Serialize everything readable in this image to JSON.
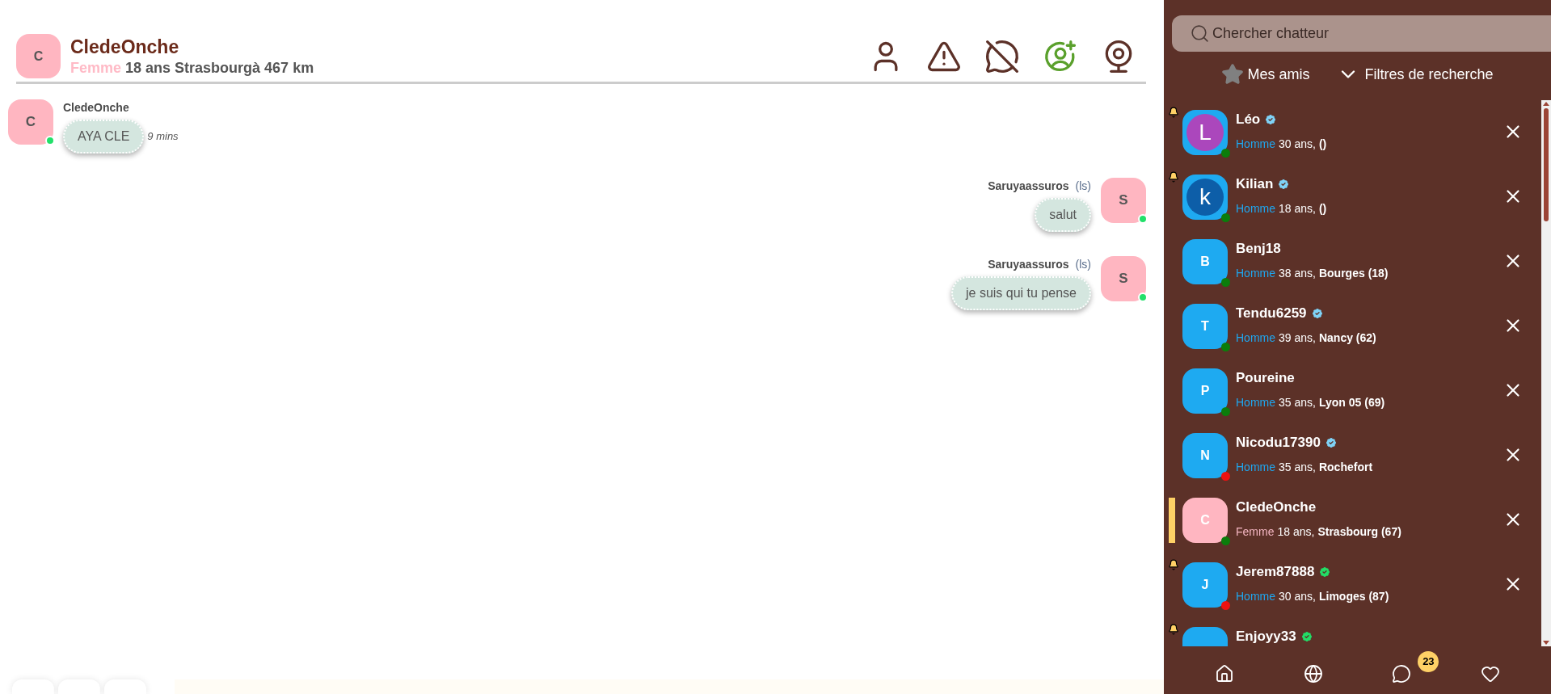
{
  "header": {
    "avatar_letter": "C",
    "name": "CledeOnche",
    "gender": "Femme",
    "details": "18 ans Strasbourgà 467 km",
    "actions": [
      {
        "kind": "profile"
      },
      {
        "kind": "report"
      },
      {
        "kind": "block-chat"
      },
      {
        "kind": "add-friend"
      },
      {
        "kind": "webcam"
      }
    ]
  },
  "messages": [
    {
      "kind": "incoming",
      "avatar_letter": "C",
      "online": true,
      "sender": "CledeOnche",
      "text": "AYA CLE",
      "time": "9 mins"
    },
    {
      "kind": "outgoing",
      "avatar_letter": "S",
      "online": true,
      "sender": "Saruyaassuros",
      "tag": "(ls)",
      "text": "salut"
    },
    {
      "kind": "outgoing",
      "avatar_letter": "S",
      "online": true,
      "sender": "Saruyaassuros",
      "tag": "(ls)",
      "text": "je suis qui tu pense"
    }
  ],
  "composer_buttons": [
    {
      "kind": "tool"
    },
    {
      "kind": "tool"
    },
    {
      "kind": "tool"
    }
  ],
  "sidebar": {
    "search": {
      "placeholder": "Chercher chatteur"
    },
    "friends_label": "Mes amis",
    "filters_label": "Filtres de recherche",
    "users": [
      {
        "name": "Léo",
        "avatar": {
          "kind": "round",
          "color": "#ab47bc",
          "letter": "L"
        },
        "status": {
          "color": "#0b7d0b"
        },
        "badge": {
          "color": "#7fd3f7"
        },
        "notified": true,
        "selected": false,
        "gender": {
          "text": "Homme",
          "color": "#1ea7f0"
        },
        "age": "30 ans,",
        "place": "()"
      },
      {
        "name": "Kilian",
        "avatar": {
          "kind": "round",
          "color": "#0d5ea8",
          "letter": "k"
        },
        "status": {
          "color": "#0b7d0b"
        },
        "badge": {
          "color": "#7fd3f7"
        },
        "notified": true,
        "selected": false,
        "gender": {
          "text": "Homme",
          "color": "#1ea7f0"
        },
        "age": "18 ans,",
        "place": "()"
      },
      {
        "name": "Benj18",
        "avatar": {
          "kind": "square",
          "color": "#1eaaf1",
          "letter": "B"
        },
        "status": {
          "color": "#0b7d0b"
        },
        "notified": false,
        "selected": false,
        "gender": {
          "text": "Homme",
          "color": "#1ea7f0"
        },
        "age": "38 ans,",
        "place": "Bourges (18)"
      },
      {
        "name": "Tendu6259",
        "avatar": {
          "kind": "square",
          "color": "#1eaaf1",
          "letter": "T"
        },
        "status": {
          "color": "#0b7d0b"
        },
        "badge": {
          "color": "#7fd3f7"
        },
        "notified": false,
        "selected": false,
        "gender": {
          "text": "Homme",
          "color": "#1ea7f0"
        },
        "age": "39 ans,",
        "place": "Nancy (62)"
      },
      {
        "name": "Poureine",
        "avatar": {
          "kind": "square",
          "color": "#1eaaf1",
          "letter": "P"
        },
        "status": {
          "color": "#0b7d0b"
        },
        "notified": false,
        "selected": false,
        "gender": {
          "text": "Homme",
          "color": "#1ea7f0"
        },
        "age": "35 ans,",
        "place": "Lyon 05 (69)"
      },
      {
        "name": "Nicodu17390",
        "avatar": {
          "kind": "square",
          "color": "#1eaaf1",
          "letter": "N"
        },
        "status": {
          "color": "#ee1111"
        },
        "badge": {
          "color": "#7fd3f7"
        },
        "notified": false,
        "selected": false,
        "gender": {
          "text": "Homme",
          "color": "#1ea7f0"
        },
        "age": "35 ans,",
        "place": "Rochefort"
      },
      {
        "name": "CledeOnche",
        "avatar": {
          "kind": "square",
          "color": "#ffb6c1",
          "letter": "C"
        },
        "status": {
          "color": "#0b7d0b"
        },
        "notified": false,
        "selected": true,
        "gender": {
          "text": "Femme",
          "color": "#f4b6c2"
        },
        "age": "18 ans,",
        "place": "Strasbourg (67)"
      },
      {
        "name": "Jerem87888",
        "avatar": {
          "kind": "square",
          "color": "#1eaaf1",
          "letter": "J"
        },
        "status": {
          "color": "#ee1111"
        },
        "badge": {
          "color": "#22dd66"
        },
        "notified": true,
        "selected": false,
        "gender": {
          "text": "Homme",
          "color": "#1ea7f0"
        },
        "age": "30 ans,",
        "place": "Limoges (87)"
      },
      {
        "name": "Enjoyy33",
        "avatar": {
          "kind": "square",
          "color": "#1eaaf1"
        },
        "badge": {
          "color": "#22dd66"
        },
        "notified": true,
        "selected": false
      }
    ],
    "nav": [
      {
        "kind": "home"
      },
      {
        "kind": "globe"
      },
      {
        "kind": "chat",
        "count": "23"
      },
      {
        "kind": "heart"
      }
    ]
  }
}
